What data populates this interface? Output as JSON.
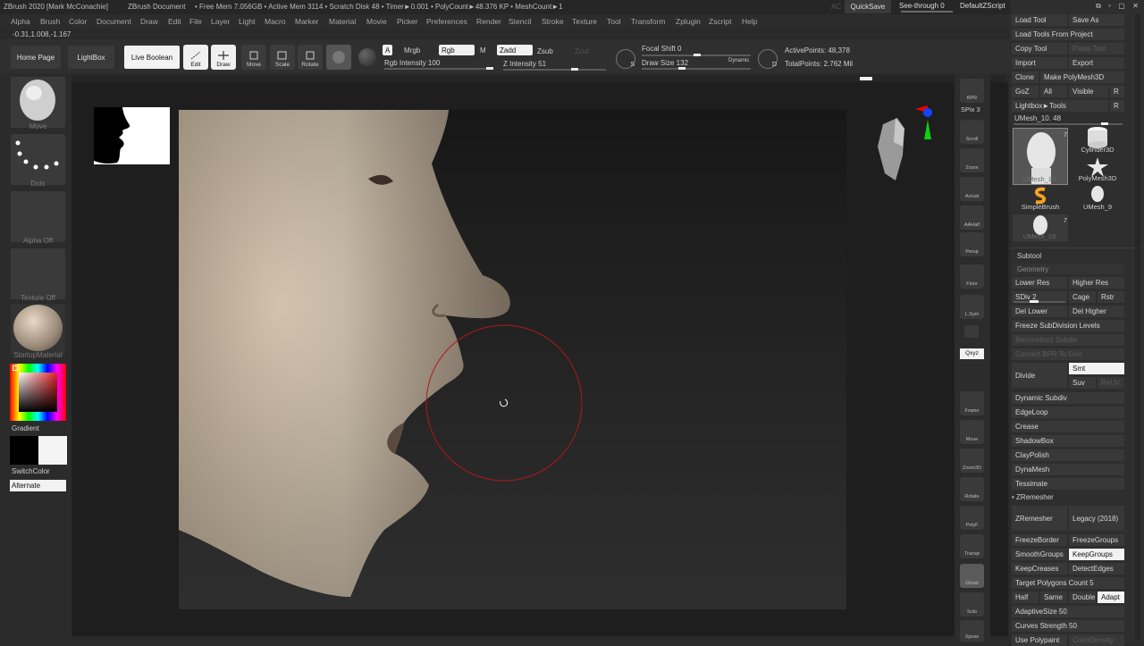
{
  "title": {
    "app": "ZBrush 2020 [Mark McConachie]",
    "document": "ZBrush Document",
    "stats": "• Free Mem 7.056GB • Active Mem 3114 • Scratch Disk 48 • Timer►0.001 • PolyCount►48.376 KP • MeshCount►1",
    "ac": "AC",
    "quicksave": "QuickSave",
    "see_through": "See-through  0",
    "zscript": "DefaultZScript"
  },
  "menu": [
    "Alpha",
    "Brush",
    "Color",
    "Document",
    "Draw",
    "Edit",
    "File",
    "Layer",
    "Light",
    "Macro",
    "Marker",
    "Material",
    "Movie",
    "Picker",
    "Preferences",
    "Render",
    "Stencil",
    "Stroke",
    "Texture",
    "Tool",
    "Transform",
    "Zplugin",
    "Zscript",
    "Help"
  ],
  "coords": "-0.31,1.008,-1.167",
  "nav": {
    "home": "Home Page",
    "lightbox": "LightBox",
    "live_boolean": "Live Boolean"
  },
  "tools": {
    "edit": "Edit",
    "draw": "Draw",
    "move": "Move",
    "scale": "Scale",
    "rotate": "Rotate"
  },
  "color_controls": {
    "a": "A",
    "mrgb": "Mrgb",
    "rgb": "Rgb",
    "m": "M",
    "zadd": "Zadd",
    "zsub": "Zsub",
    "zcut": "Zcut",
    "rgb_intensity": "Rgb Intensity 100",
    "z_intensity": "Z Intensity 51"
  },
  "draw_controls": {
    "focal_shift": "Focal Shift 0",
    "draw_size": "Draw Size 132",
    "dynamic": "Dynamic",
    "s_badge": "S",
    "d_badge": "D"
  },
  "points": {
    "active": "ActivePoints: 48,378",
    "total": "TotalPoints: 2.762 Mil"
  },
  "left_shelf": {
    "brush": "Move",
    "stroke": "Dots",
    "alpha": "Alpha Off",
    "texture": "Texture Off",
    "material": "StartupMaterial",
    "gradient": "Gradient",
    "switch": "SwitchColor",
    "alternate": "Alternate"
  },
  "right_shelf": {
    "bpr": "BPR",
    "spix": "SPix 3",
    "scroll": "Scroll",
    "zoom": "Zoom",
    "actual": "Actual",
    "aahalf": "AAHalf",
    "dynamic": "Dynamic",
    "persp": "Persp",
    "floor": "Floor",
    "lsym": "L.Sym",
    "xyz": "Qxyz",
    "frame": "Frame",
    "move": "Move",
    "zoom3d": "Zoom3D",
    "rotate": "Rotate",
    "linefill": "Line Fill",
    "polyf": "PolyF",
    "transp": "Transp",
    "ghost": "Ghost",
    "solo": "Solo",
    "xpose": "Xpose"
  },
  "tool_palette": {
    "load_tool": "Load Tool",
    "save_as": "Save As",
    "load_from_project": "Load Tools From Project",
    "copy_tool": "Copy Tool",
    "paste_tool": "Paste Tool",
    "import": "Import",
    "export": "Export",
    "clone": "Clone",
    "make_polymesh": "Make PolyMesh3D",
    "goz": "GoZ",
    "all": "All",
    "visible": "Visible",
    "r": "R",
    "lightbox_tools": "Lightbox►Tools",
    "current_tool": "UMesh_10. 48",
    "r2": "R",
    "meshes": [
      {
        "name": "UMesh_10",
        "count": "7"
      },
      {
        "name": "Cylinder3D",
        "count": ""
      },
      {
        "name": "PolyMesh3D",
        "count": ""
      },
      {
        "name": "SimpleBrush",
        "count": ""
      },
      {
        "name": "UMesh_9",
        "count": ""
      },
      {
        "name": "UMesh_10",
        "count": "7"
      }
    ]
  },
  "subtool": {
    "subtool": "Subtool",
    "geometry": "Geometry",
    "lower_res": "Lower Res",
    "higher_res": "Higher Res",
    "sdiv": "SDiv 2",
    "cage": "Cage",
    "rstr": "Rstr",
    "del_lower": "Del Lower",
    "del_higher": "Del Higher",
    "freeze": "Freeze SubDivision Levels",
    "reconstruct": "Reconstruct Subdiv",
    "convert_bpr": "Convert BPR To Geo",
    "divide": "Divide",
    "smt": "Smt",
    "suv": "Suv",
    "reuv": "ReUV",
    "dynamic_subdiv": "Dynamic Subdiv",
    "edgeloop": "EdgeLoop",
    "crease": "Crease",
    "shadowbox": "ShadowBox",
    "claypolish": "ClayPolish",
    "dynamesh": "DynaMesh",
    "tessimate": "Tessimate",
    "zremesher_header": "ZRemesher",
    "zremesher": "ZRemesher",
    "legacy": "Legacy (2018)",
    "freeze_border": "FreezeBorder",
    "freeze_groups": "FreezeGroups",
    "smooth_groups": "SmoothGroups",
    "keep_groups": "KeepGroups",
    "keep_creases": "KeepCreases",
    "detect_edges": "DetectEdges",
    "target_poly": "Target Polygons Count 5",
    "half": "Half",
    "same": "Same",
    "double": "Double",
    "adapt": "Adapt",
    "adaptive_size": "AdaptiveSize 50",
    "curves_strength": "Curves Strength 50",
    "use_polypaint": "Use Polypaint",
    "color_density": "ColorDensity"
  },
  "colors": {
    "brush_ring": "#b01818",
    "primary": "#000000",
    "secondary": "#ffffff",
    "skin": "#c8b8a4"
  }
}
